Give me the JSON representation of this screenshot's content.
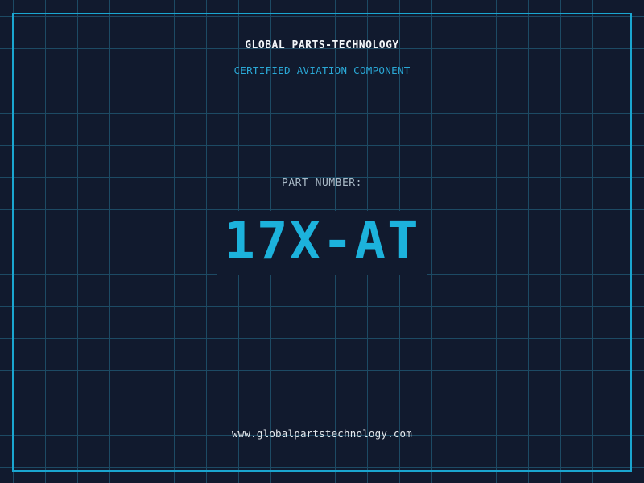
{
  "header": {
    "brand": "GLOBAL PARTS-TECHNOLOGY",
    "tagline": "CERTIFIED AVIATION COMPONENT"
  },
  "part": {
    "label": "PART NUMBER:",
    "number": "17X-AT"
  },
  "footer": {
    "website": "www.globalpartstechnology.com"
  },
  "colors": {
    "background": "#111a2e",
    "grid": "#1d4a64",
    "accent": "#1cb2dc",
    "border": "#1aa6d0"
  }
}
